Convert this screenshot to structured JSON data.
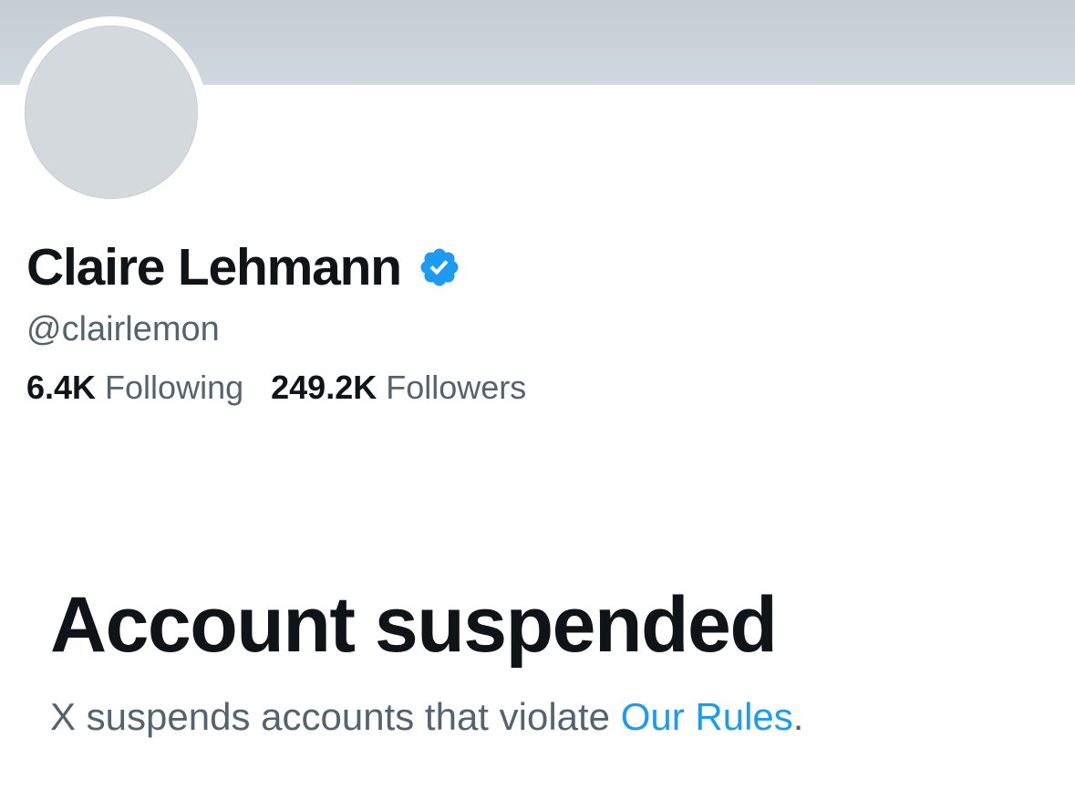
{
  "profile": {
    "display_name": "Claire Lehmann",
    "handle": "@clairlemon",
    "verified": true,
    "verified_badge_icon": "verified-badge-icon",
    "verified_color": "#1d9bf0",
    "following_count": "6.4K",
    "following_label": "Following",
    "followers_count": "249.2K",
    "followers_label": "Followers"
  },
  "suspension": {
    "heading": "Account suspended",
    "message_prefix": "X suspends accounts that violate ",
    "rules_link_text": "Our Rules",
    "message_suffix": "."
  },
  "colors": {
    "banner": "#cfd9de",
    "avatar_placeholder": "#d4d9de",
    "primary_text": "#0f1419",
    "secondary_text": "#536471",
    "link": "#1d9bf0"
  }
}
